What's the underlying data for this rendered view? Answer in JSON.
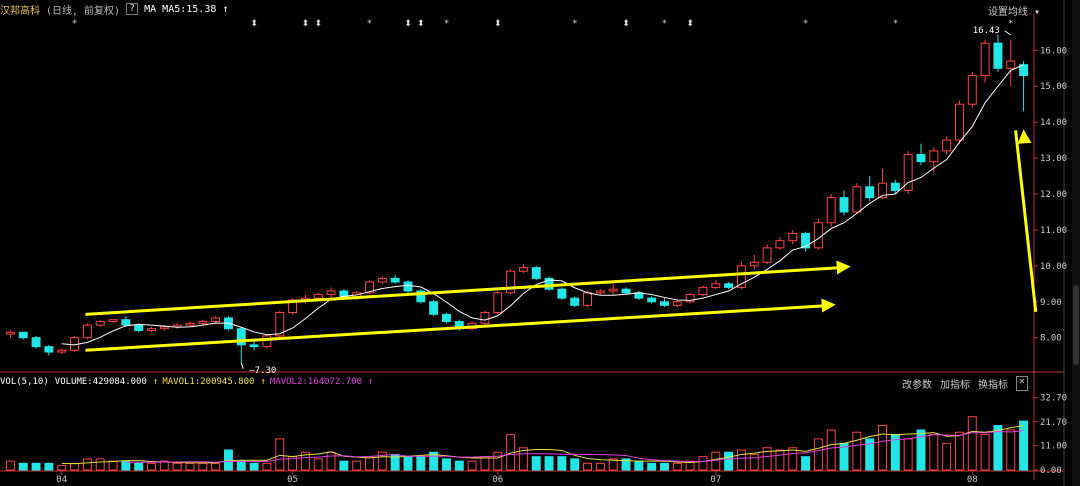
{
  "header": {
    "stock_name": "汉邦高科",
    "chart_mode": "(日线, 前复权)",
    "q_button": "?",
    "ma_label": "MA",
    "ma5_value": "MA5:15.38",
    "arrow": "↑",
    "settings": "设置均线",
    "settings_caret": "▾"
  },
  "volume_header": {
    "label": "VOL(5,10)",
    "volume": "VOLUME:429084.000",
    "mavol1": "MAVOL1:200945.800",
    "mavol2": "MAVOL2:164072.700",
    "arrow": "↑",
    "change_params": "改参数",
    "add_indicator": "加指标",
    "swap_indicator": "换指标",
    "close": "✕"
  },
  "colors": {
    "up": "#ff4444",
    "down": "#22e6e6",
    "ma_line": "#ffffff",
    "mavol1": "#e6e040",
    "mavol2": "#e040e0",
    "trend": "#ffff00",
    "axis": "#c03030"
  },
  "chart_data": {
    "type": "candlestick",
    "price_axis": {
      "ticks": [
        8.0,
        9.0,
        10.0,
        11.0,
        12.0,
        13.0,
        14.0,
        15.0,
        16.0
      ],
      "labels": [
        "8.00",
        "9.00",
        "10.00",
        "11.00",
        "12.00",
        "13.00",
        "14.00",
        "15.00",
        "16.00"
      ],
      "ylim": [
        7.1,
        16.9
      ]
    },
    "volume_axis": {
      "ticks": [
        0.0,
        11.0,
        21.7,
        32.7
      ],
      "labels": [
        "0.00",
        "11.00",
        "21.70",
        "32.70"
      ],
      "ylim": [
        0,
        36
      ]
    },
    "x_labels": [
      {
        "index": 4,
        "label": "04"
      },
      {
        "index": 22,
        "label": "05"
      },
      {
        "index": 38,
        "label": "06"
      },
      {
        "index": 55,
        "label": "07"
      },
      {
        "index": 75,
        "label": "08"
      }
    ],
    "annotations": [
      {
        "index": 18,
        "price": 7.3,
        "label": "7.30"
      },
      {
        "index": 78,
        "price": 16.43,
        "label": "16.43"
      }
    ],
    "event_markers": [
      {
        "index": 5,
        "symbol": "*"
      },
      {
        "index": 19,
        "symbol": "⬍"
      },
      {
        "index": 23,
        "symbol": "⬍"
      },
      {
        "index": 24,
        "symbol": "⬍"
      },
      {
        "index": 28,
        "symbol": "*"
      },
      {
        "index": 31,
        "symbol": "⬍"
      },
      {
        "index": 32,
        "symbol": "⬍"
      },
      {
        "index": 34,
        "symbol": "*"
      },
      {
        "index": 38,
        "symbol": "⬍"
      },
      {
        "index": 44,
        "symbol": "*"
      },
      {
        "index": 48,
        "symbol": "⬍"
      },
      {
        "index": 51,
        "symbol": "*"
      },
      {
        "index": 53,
        "symbol": "⬍"
      },
      {
        "index": 62,
        "symbol": "*"
      },
      {
        "index": 69,
        "symbol": "*"
      },
      {
        "index": 78,
        "symbol": "*"
      }
    ],
    "candles": [
      [
        8.1,
        8.2,
        8.0,
        8.15
      ],
      [
        8.15,
        8.15,
        7.95,
        8.0
      ],
      [
        8.0,
        8.05,
        7.7,
        7.75
      ],
      [
        7.75,
        7.8,
        7.5,
        7.6
      ],
      [
        7.6,
        7.7,
        7.55,
        7.65
      ],
      [
        7.65,
        8.05,
        7.6,
        8.0
      ],
      [
        8.0,
        8.4,
        7.95,
        8.35
      ],
      [
        8.35,
        8.5,
        8.3,
        8.45
      ],
      [
        8.45,
        8.5,
        8.4,
        8.5
      ],
      [
        8.5,
        8.6,
        8.3,
        8.35
      ],
      [
        8.35,
        8.4,
        8.15,
        8.2
      ],
      [
        8.2,
        8.3,
        8.15,
        8.25
      ],
      [
        8.25,
        8.35,
        8.2,
        8.3
      ],
      [
        8.3,
        8.4,
        8.25,
        8.35
      ],
      [
        8.35,
        8.45,
        8.3,
        8.4
      ],
      [
        8.4,
        8.5,
        8.35,
        8.45
      ],
      [
        8.45,
        8.6,
        8.4,
        8.55
      ],
      [
        8.55,
        8.6,
        8.2,
        8.25
      ],
      [
        8.25,
        8.3,
        7.3,
        7.8
      ],
      [
        7.8,
        7.9,
        7.65,
        7.75
      ],
      [
        7.75,
        8.1,
        7.7,
        8.05
      ],
      [
        8.05,
        8.75,
        8.0,
        8.7
      ],
      [
        8.7,
        9.1,
        8.65,
        9.05
      ],
      [
        9.05,
        9.2,
        8.95,
        9.1
      ],
      [
        9.1,
        9.25,
        9.05,
        9.2
      ],
      [
        9.2,
        9.4,
        9.05,
        9.3
      ],
      [
        9.3,
        9.35,
        9.05,
        9.1
      ],
      [
        9.1,
        9.3,
        9.05,
        9.25
      ],
      [
        9.25,
        9.6,
        9.2,
        9.55
      ],
      [
        9.55,
        9.7,
        9.5,
        9.65
      ],
      [
        9.65,
        9.75,
        9.5,
        9.55
      ],
      [
        9.55,
        9.6,
        9.25,
        9.3
      ],
      [
        9.3,
        9.35,
        8.95,
        9.0
      ],
      [
        9.0,
        9.05,
        8.6,
        8.65
      ],
      [
        8.65,
        8.7,
        8.4,
        8.45
      ],
      [
        8.45,
        8.5,
        8.2,
        8.25
      ],
      [
        8.25,
        8.45,
        8.2,
        8.4
      ],
      [
        8.4,
        8.75,
        8.35,
        8.7
      ],
      [
        8.7,
        9.3,
        8.65,
        9.25
      ],
      [
        9.25,
        9.9,
        9.2,
        9.85
      ],
      [
        9.85,
        10.05,
        9.8,
        9.95
      ],
      [
        9.95,
        10.0,
        9.6,
        9.65
      ],
      [
        9.65,
        9.7,
        9.3,
        9.35
      ],
      [
        9.35,
        9.4,
        9.05,
        9.1
      ],
      [
        9.1,
        9.15,
        8.85,
        8.9
      ],
      [
        8.9,
        9.3,
        8.85,
        9.25
      ],
      [
        9.25,
        9.35,
        9.2,
        9.3
      ],
      [
        9.3,
        9.5,
        9.2,
        9.35
      ],
      [
        9.35,
        9.4,
        9.2,
        9.25
      ],
      [
        9.25,
        9.3,
        9.05,
        9.1
      ],
      [
        9.1,
        9.15,
        8.95,
        9.0
      ],
      [
        9.0,
        9.1,
        8.85,
        8.9
      ],
      [
        8.9,
        9.05,
        8.85,
        9.0
      ],
      [
        9.0,
        9.25,
        8.95,
        9.2
      ],
      [
        9.2,
        9.45,
        9.15,
        9.4
      ],
      [
        9.4,
        9.6,
        9.35,
        9.5
      ],
      [
        9.5,
        9.55,
        9.35,
        9.4
      ],
      [
        9.4,
        10.1,
        9.35,
        10.0
      ],
      [
        10.0,
        10.3,
        9.9,
        10.1
      ],
      [
        10.1,
        10.6,
        10.05,
        10.5
      ],
      [
        10.5,
        10.8,
        10.45,
        10.7
      ],
      [
        10.7,
        11.0,
        10.6,
        10.9
      ],
      [
        10.9,
        10.95,
        10.4,
        10.5
      ],
      [
        10.5,
        11.3,
        10.45,
        11.2
      ],
      [
        11.2,
        12.0,
        11.1,
        11.9
      ],
      [
        11.9,
        12.1,
        11.4,
        11.5
      ],
      [
        11.5,
        12.3,
        11.45,
        12.2
      ],
      [
        12.2,
        12.5,
        11.8,
        11.9
      ],
      [
        11.9,
        12.7,
        11.85,
        12.3
      ],
      [
        12.3,
        12.4,
        12.0,
        12.1
      ],
      [
        12.1,
        13.2,
        12.0,
        13.1
      ],
      [
        13.1,
        13.4,
        12.8,
        12.9
      ],
      [
        12.9,
        13.3,
        12.6,
        13.2
      ],
      [
        13.2,
        13.6,
        13.1,
        13.5
      ],
      [
        13.5,
        14.6,
        13.4,
        14.5
      ],
      [
        14.5,
        15.4,
        14.4,
        15.3
      ],
      [
        15.3,
        16.3,
        15.1,
        16.2
      ],
      [
        16.2,
        16.43,
        15.4,
        15.5
      ],
      [
        15.5,
        16.3,
        15.0,
        15.7
      ],
      [
        15.6,
        15.7,
        14.3,
        15.3
      ]
    ],
    "volumes": [
      4,
      3,
      3,
      3,
      2,
      3,
      5,
      5,
      4,
      4,
      3,
      3,
      4,
      3,
      3,
      3,
      3,
      9,
      4,
      3,
      3,
      14,
      6,
      8,
      5,
      8,
      4,
      4,
      6,
      8,
      7,
      6,
      6,
      8,
      5,
      4,
      4,
      6,
      8,
      16,
      10,
      6,
      6,
      6,
      5,
      3,
      3,
      5,
      5,
      4,
      3,
      3,
      3,
      4,
      6,
      8,
      8,
      9,
      7,
      10,
      9,
      10,
      6,
      14,
      18,
      12,
      17,
      14,
      20,
      16,
      14,
      18,
      16,
      12,
      17,
      24,
      16,
      20,
      18,
      22
    ]
  }
}
